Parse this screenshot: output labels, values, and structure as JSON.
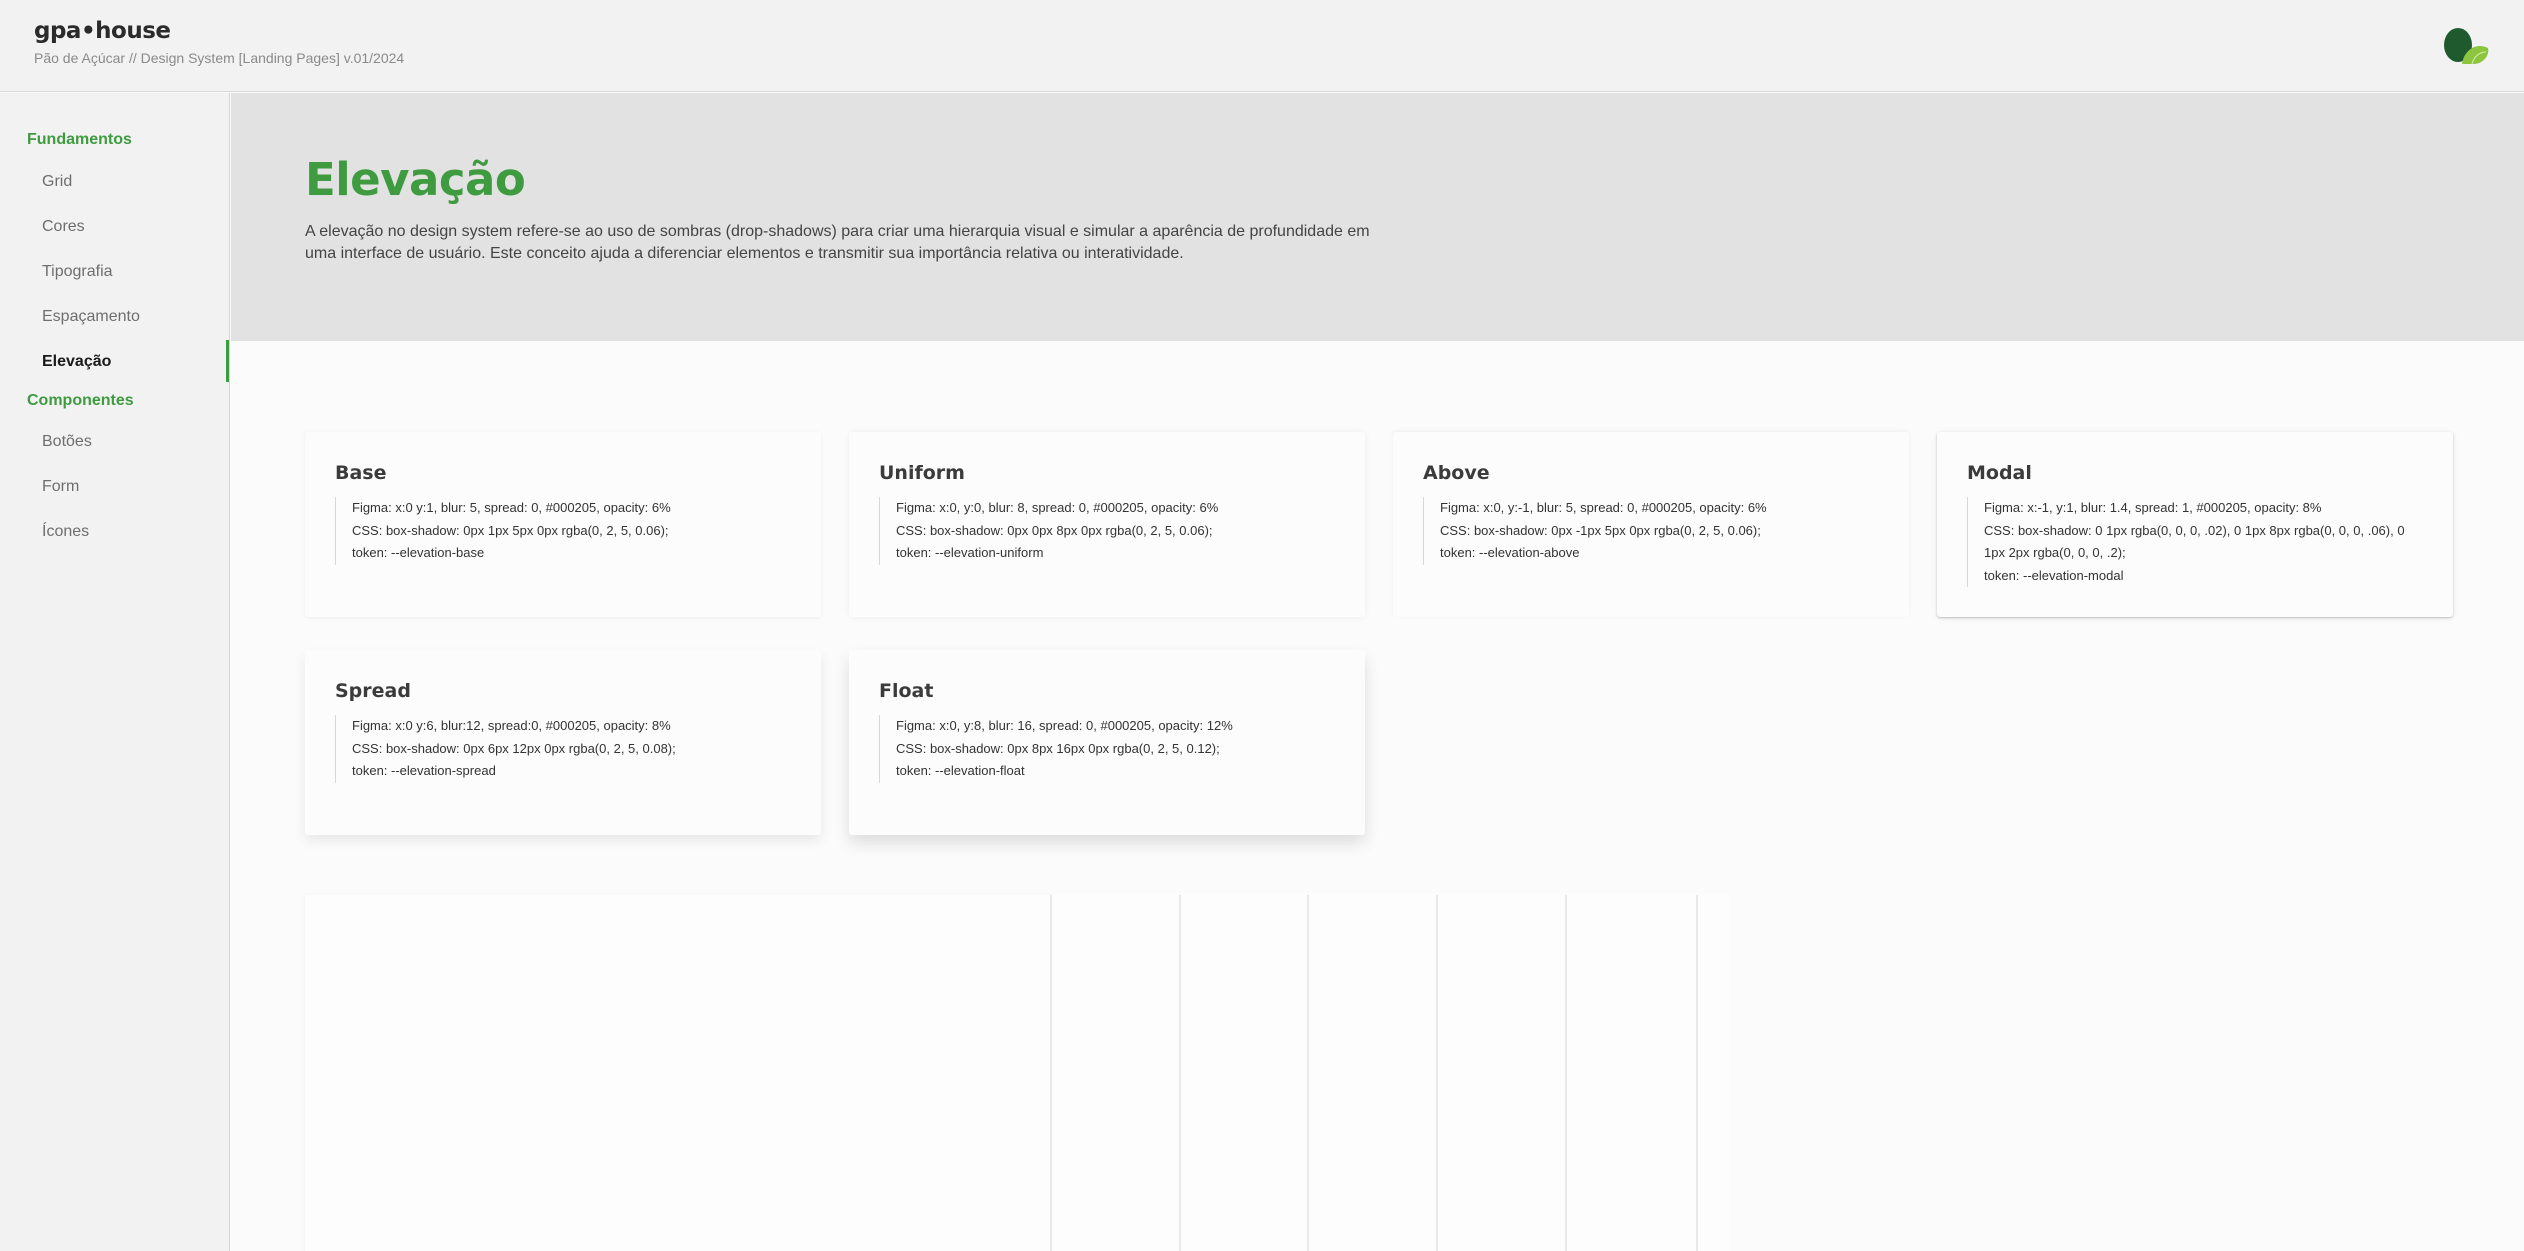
{
  "header": {
    "brand": "gpa•house",
    "subtitle": "Pão de Açúcar // Design System [Landing Pages] v.01/2024",
    "logo_icon": "leaf-logo-icon"
  },
  "sidebar": {
    "sections": [
      {
        "label": "Fundamentos",
        "items": [
          {
            "label": "Grid"
          },
          {
            "label": "Cores"
          },
          {
            "label": "Tipografia"
          },
          {
            "label": "Espaçamento"
          },
          {
            "label": "Elevação",
            "active": true
          }
        ]
      },
      {
        "label": "Componentes",
        "items": [
          {
            "label": "Botões"
          },
          {
            "label": "Form"
          },
          {
            "label": "Ícones"
          }
        ]
      }
    ]
  },
  "hero": {
    "title": "Elevação",
    "description": "A elevação no design system refere-se ao uso de sombras (drop-shadows) para criar uma hierarquia visual e simular a aparência de profundidade em uma interface de usuário. Este conceito ajuda a diferenciar elementos e transmitir sua importância relativa ou interatividade."
  },
  "cards": [
    {
      "title": "Base",
      "figma": "Figma: x:0 y:1, blur: 5, spread: 0, #000205, opacity: 6%",
      "css": "CSS: box-shadow: 0px 1px 5px 0px rgba(0, 2, 5, 0.06);",
      "token": "token: --elevation-base"
    },
    {
      "title": "Uniform",
      "figma": "Figma: x:0, y:0, blur: 8, spread: 0, #000205, opacity: 6%",
      "css": "CSS: box-shadow: 0px 0px 8px 0px rgba(0, 2, 5, 0.06);",
      "token": "token: --elevation-uniform"
    },
    {
      "title": "Above",
      "figma": "Figma: x:0, y:-1, blur: 5, spread: 0, #000205, opacity: 6%",
      "css": "CSS: box-shadow: 0px -1px 5px 0px rgba(0, 2, 5, 0.06);",
      "token": "token: --elevation-above"
    },
    {
      "title": "Modal",
      "figma": "Figma: x:-1, y:1, blur: 1.4, spread: 1, #000205, opacity: 8%",
      "css": "CSS: box-shadow: 0 1px rgba(0, 0, 0, .02), 0 1px 8px rgba(0, 0, 0, .06), 0 1px 2px rgba(0, 0, 0, .2);",
      "token": "token: --elevation-modal"
    },
    {
      "title": "Spread",
      "figma": "Figma: x:0 y:6, blur:12, spread:0, #000205, opacity: 8%",
      "css": "CSS: box-shadow: 0px 6px 12px 0px rgba(0, 2, 5, 0.08);",
      "token": "token: --elevation-spread"
    },
    {
      "title": "Float",
      "figma": "Figma: x:0, y:8, blur: 16, spread: 0, #000205, opacity: 12%",
      "css": "CSS: box-shadow: 0px 8px 16px 0px rgba(0, 2, 5, 0.12);",
      "token": "token: --elevation-float"
    }
  ],
  "colors": {
    "accent": "#3f9b3f",
    "header_bg": "#f2f2f3",
    "hero_bg": "#e2e2e3"
  }
}
